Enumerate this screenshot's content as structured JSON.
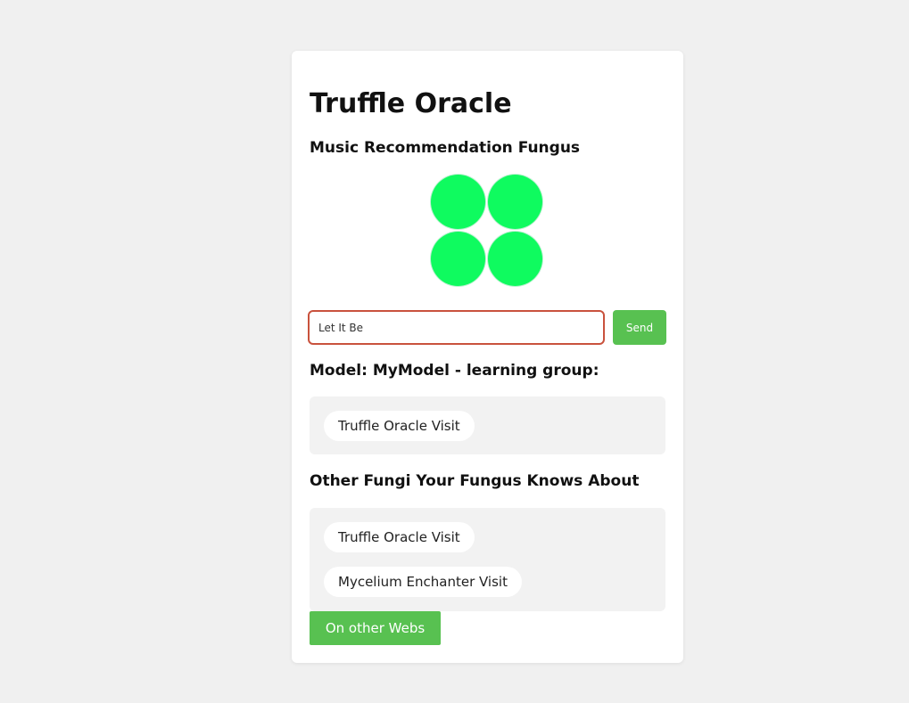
{
  "app": {
    "title": "Truffle Oracle",
    "subtitle": "Music Recommendation Fungus"
  },
  "logo": {
    "icon": "four-dot-fungus-logo",
    "color": "#0ffb5f"
  },
  "search": {
    "value": "Let It Be",
    "send_label": "Send"
  },
  "model": {
    "heading": "Model: MyModel - learning group:",
    "links": [
      {
        "label": "Truffle Oracle Visit"
      }
    ]
  },
  "other_fungi": {
    "heading": "Other Fungi Your Fungus Knows About",
    "links": [
      {
        "label": "Truffle Oracle Visit"
      },
      {
        "label": "Mycelium Enchanter Visit"
      }
    ]
  },
  "footer": {
    "other_webs_label": "On other Webs"
  },
  "colors": {
    "accent_green": "#58c151",
    "input_border": "#c9523d",
    "page_background": "#f0f0f0"
  }
}
